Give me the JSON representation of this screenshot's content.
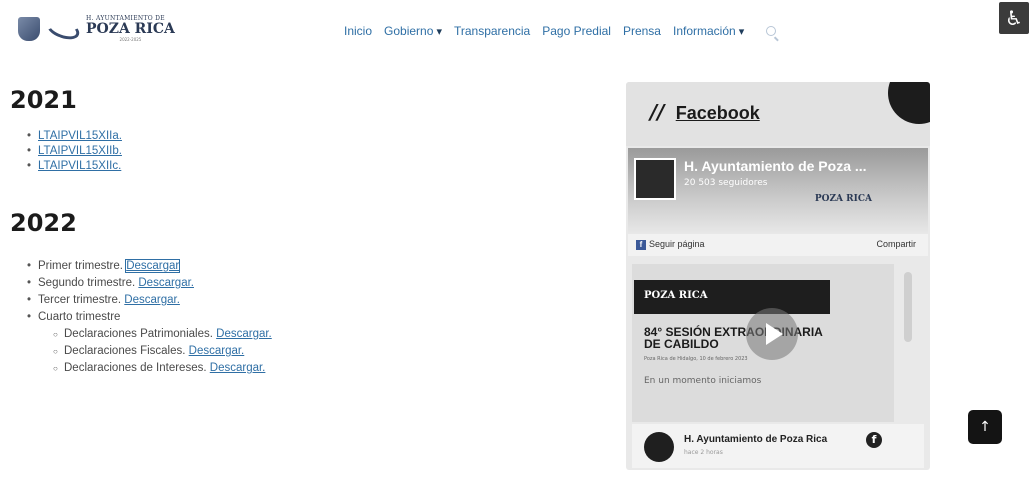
{
  "header": {
    "logo_small": "H. AYUNTAMIENTO DE",
    "logo_big": "POZA RICA",
    "logo_tiny": "2022-2025",
    "nav": [
      "Inicio",
      "Gobierno",
      "Transparencia",
      "Pago Predial",
      "Prensa",
      "Información"
    ]
  },
  "accessibility_icon": "♿",
  "sections": {
    "y2021": {
      "title": "2021",
      "links": [
        "LTAIPVIL15XIIa.",
        "LTAIPVIL15XIIb.",
        "LTAIPVIL15XIIc."
      ]
    },
    "y2022": {
      "title": "2022",
      "items": [
        {
          "label": "Primer trimestre.",
          "link": "Descargar"
        },
        {
          "label": "Segundo trimestre.",
          "link": "Descargar."
        },
        {
          "label": "Tercer trimestre.",
          "link": "Descargar."
        },
        {
          "label": "Cuarto trimestre"
        }
      ],
      "subitems": [
        {
          "label": "Declaraciones Patrimoniales.",
          "link": "Descargar."
        },
        {
          "label": "Declaraciones Fiscales.",
          "link": "Descargar."
        },
        {
          "label": "Declaraciones de Intereses.",
          "link": "Descargar."
        }
      ]
    }
  },
  "facebook": {
    "slash": "//",
    "title": "Facebook",
    "page_name": "H. Ayuntamiento de Poza ...",
    "followers": "20 503 seguidores",
    "cover_brand": "POZA RICA",
    "follow_label": "Seguir página",
    "share_label": "Compartir",
    "post_banner": "POZA RICA",
    "post_headline": "84° SESIÓN EXTRAORDINARIA DE CABILDO",
    "post_place": "Poza Rica de Hidalgo, 10 de febrero 2023",
    "post_moment": "En un momento iniciamos",
    "footer_name": "H. Ayuntamiento de Poza Rica",
    "footer_time": "hace 2 horas",
    "footer_icon": "f"
  },
  "scroll_top_label": "↑"
}
